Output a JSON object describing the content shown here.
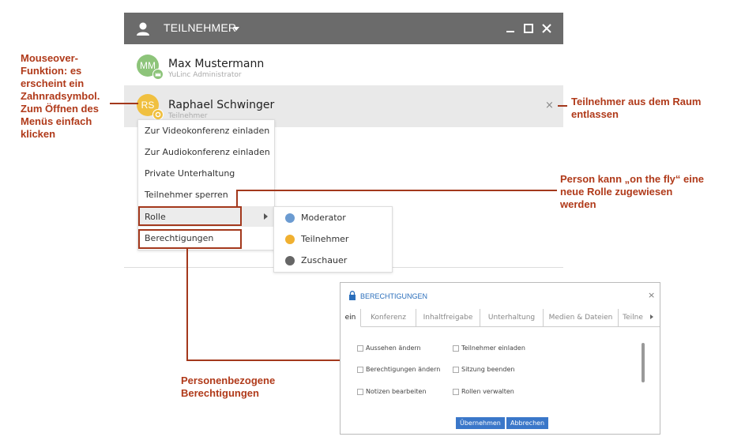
{
  "window": {
    "title": "TEILNEHMER"
  },
  "participants": [
    {
      "initials": "MM",
      "name": "Max Mustermann",
      "role": "YuLinc Administrator",
      "avatar_color": "#8dc47a",
      "badge_color": "#8dc47a"
    },
    {
      "initials": "RS",
      "name": "Raphael Schwinger",
      "role": "Teilnehmer",
      "avatar_color": "#f0c040",
      "badge_color": "#f0c040",
      "kick": "×"
    }
  ],
  "context_menu": {
    "items": [
      "Zur Videokonferenz einladen",
      "Zur Audiokonferenz einladen",
      "Private Unterhaltung",
      "Teilnehmer sperren",
      "Rolle",
      "Berechtigungen"
    ]
  },
  "role_submenu": {
    "items": [
      {
        "label": "Moderator",
        "icon_color": "#6b9bd1"
      },
      {
        "label": "Teilnehmer",
        "icon_color": "#f0b030"
      },
      {
        "label": "Zuschauer",
        "icon_color": "#666666"
      }
    ]
  },
  "annotations": {
    "mouseover": "Mouseover-\nFunktion: es\nerscheint ein\nZahnradsymbol.\nZum Öffnen des\nMenüs einfach\nklicken",
    "kick": "Teilnehmer aus dem Raum\nentlassen",
    "role": "Person kann „on the fly“ eine\nneue Rolle zugewiesen\nwerden",
    "perms": "Personenbezogene\nBerechtigungen"
  },
  "dialog": {
    "title": "BERECHTIGUNGEN",
    "close": "×",
    "tabs": [
      "ein",
      "Konferenz",
      "Inhaltfreigabe",
      "Unterhaltung",
      "Medien & Dateien",
      "Teilne"
    ],
    "permissions_left": [
      "Aussehen ändern",
      "Berechtigungen ändern",
      "Notizen bearbeiten"
    ],
    "permissions_right": [
      "Teilnehmer einladen",
      "Sitzung beenden",
      "Rollen verwalten"
    ],
    "apply": "Übernehmen",
    "cancel": "Abbrechen"
  },
  "colors": {
    "header": "#6b6b6b",
    "annotation": "#b03a1a",
    "highlight": "#a3381c",
    "dialog_accent": "#2a6ebb",
    "button": "#3a77c9"
  }
}
